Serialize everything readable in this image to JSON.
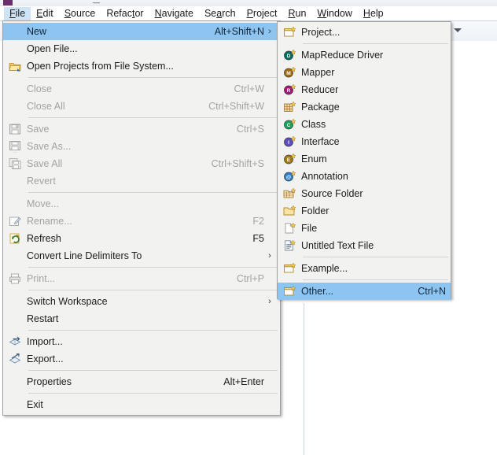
{
  "window": {
    "title_fragment": "",
    "minimize_glyph": "—"
  },
  "menubar": {
    "items": [
      {
        "label": "File",
        "mnemonic": "F",
        "active": true
      },
      {
        "label": "Edit",
        "mnemonic": "E",
        "active": false
      },
      {
        "label": "Source",
        "mnemonic": "S",
        "active": false
      },
      {
        "label": "Refactor",
        "mnemonic": "t",
        "active": false
      },
      {
        "label": "Navigate",
        "mnemonic": "N",
        "active": false
      },
      {
        "label": "Search",
        "mnemonic": "a",
        "active": false
      },
      {
        "label": "Project",
        "mnemonic": "P",
        "active": false
      },
      {
        "label": "Run",
        "mnemonic": "R",
        "active": false
      },
      {
        "label": "Window",
        "mnemonic": "W",
        "active": false
      },
      {
        "label": "Help",
        "mnemonic": "H",
        "active": false
      }
    ]
  },
  "file_menu": {
    "items": [
      {
        "type": "item",
        "label": "New",
        "accel": "Alt+Shift+N",
        "arrow": "›",
        "selected": true,
        "disabled": false,
        "icon": ""
      },
      {
        "type": "item",
        "label": "Open File...",
        "accel": "",
        "arrow": "",
        "selected": false,
        "disabled": false,
        "icon": ""
      },
      {
        "type": "item",
        "label": "Open Projects from File System...",
        "accel": "",
        "arrow": "",
        "selected": false,
        "disabled": false,
        "icon": "open-folder-icon"
      },
      {
        "type": "sep"
      },
      {
        "type": "item",
        "label": "Close",
        "accel": "Ctrl+W",
        "arrow": "",
        "selected": false,
        "disabled": true,
        "icon": ""
      },
      {
        "type": "item",
        "label": "Close All",
        "accel": "Ctrl+Shift+W",
        "arrow": "",
        "selected": false,
        "disabled": true,
        "icon": ""
      },
      {
        "type": "sep"
      },
      {
        "type": "item",
        "label": "Save",
        "accel": "Ctrl+S",
        "arrow": "",
        "selected": false,
        "disabled": true,
        "icon": "save-icon"
      },
      {
        "type": "item",
        "label": "Save As...",
        "accel": "",
        "arrow": "",
        "selected": false,
        "disabled": true,
        "icon": "save-as-icon"
      },
      {
        "type": "item",
        "label": "Save All",
        "accel": "Ctrl+Shift+S",
        "arrow": "",
        "selected": false,
        "disabled": true,
        "icon": "save-all-icon"
      },
      {
        "type": "item",
        "label": "Revert",
        "accel": "",
        "arrow": "",
        "selected": false,
        "disabled": true,
        "icon": ""
      },
      {
        "type": "sep"
      },
      {
        "type": "item",
        "label": "Move...",
        "accel": "",
        "arrow": "",
        "selected": false,
        "disabled": true,
        "icon": ""
      },
      {
        "type": "item",
        "label": "Rename...",
        "accel": "F2",
        "arrow": "",
        "selected": false,
        "disabled": true,
        "icon": "rename-icon"
      },
      {
        "type": "item",
        "label": "Refresh",
        "accel": "F5",
        "arrow": "",
        "selected": false,
        "disabled": false,
        "icon": "refresh-icon"
      },
      {
        "type": "item",
        "label": "Convert Line Delimiters To",
        "accel": "",
        "arrow": "›",
        "selected": false,
        "disabled": false,
        "icon": ""
      },
      {
        "type": "sep"
      },
      {
        "type": "item",
        "label": "Print...",
        "accel": "Ctrl+P",
        "arrow": "",
        "selected": false,
        "disabled": true,
        "icon": "print-icon"
      },
      {
        "type": "sep"
      },
      {
        "type": "item",
        "label": "Switch Workspace",
        "accel": "",
        "arrow": "›",
        "selected": false,
        "disabled": false,
        "icon": ""
      },
      {
        "type": "item",
        "label": "Restart",
        "accel": "",
        "arrow": "",
        "selected": false,
        "disabled": false,
        "icon": ""
      },
      {
        "type": "sep"
      },
      {
        "type": "item",
        "label": "Import...",
        "accel": "",
        "arrow": "",
        "selected": false,
        "disabled": false,
        "icon": "import-icon"
      },
      {
        "type": "item",
        "label": "Export...",
        "accel": "",
        "arrow": "",
        "selected": false,
        "disabled": false,
        "icon": "export-icon"
      },
      {
        "type": "sep"
      },
      {
        "type": "item",
        "label": "Properties",
        "accel": "Alt+Enter",
        "arrow": "",
        "selected": false,
        "disabled": false,
        "icon": ""
      },
      {
        "type": "sep"
      },
      {
        "type": "item",
        "label": "Exit",
        "accel": "",
        "arrow": "",
        "selected": false,
        "disabled": false,
        "icon": ""
      }
    ]
  },
  "new_submenu": {
    "items": [
      {
        "type": "item",
        "label": "Project...",
        "accel": "",
        "selected": false,
        "icon": "new-project-icon"
      },
      {
        "type": "sep"
      },
      {
        "type": "item",
        "label": "MapReduce Driver",
        "accel": "",
        "selected": false,
        "icon": "mapreduce-driver-icon"
      },
      {
        "type": "item",
        "label": "Mapper",
        "accel": "",
        "selected": false,
        "icon": "mapper-icon"
      },
      {
        "type": "item",
        "label": "Reducer",
        "accel": "",
        "selected": false,
        "icon": "reducer-icon"
      },
      {
        "type": "item",
        "label": "Package",
        "accel": "",
        "selected": false,
        "icon": "package-icon"
      },
      {
        "type": "item",
        "label": "Class",
        "accel": "",
        "selected": false,
        "icon": "class-icon"
      },
      {
        "type": "item",
        "label": "Interface",
        "accel": "",
        "selected": false,
        "icon": "interface-icon"
      },
      {
        "type": "item",
        "label": "Enum",
        "accel": "",
        "selected": false,
        "icon": "enum-icon"
      },
      {
        "type": "item",
        "label": "Annotation",
        "accel": "",
        "selected": false,
        "icon": "annotation-icon"
      },
      {
        "type": "item",
        "label": "Source Folder",
        "accel": "",
        "selected": false,
        "icon": "source-folder-icon"
      },
      {
        "type": "item",
        "label": "Folder",
        "accel": "",
        "selected": false,
        "icon": "folder-icon"
      },
      {
        "type": "item",
        "label": "File",
        "accel": "",
        "selected": false,
        "icon": "file-icon"
      },
      {
        "type": "item",
        "label": "Untitled Text File",
        "accel": "",
        "selected": false,
        "icon": "untitled-text-file-icon"
      },
      {
        "type": "sep"
      },
      {
        "type": "item",
        "label": "Example...",
        "accel": "",
        "selected": false,
        "icon": "example-icon"
      },
      {
        "type": "sep"
      },
      {
        "type": "item",
        "label": "Other...",
        "accel": "Ctrl+N",
        "selected": true,
        "icon": "other-icon"
      }
    ]
  },
  "toolbar": {
    "overflow_chevron": "chevron-down-icon"
  },
  "colors": {
    "menu_bg": "#f2f2f0",
    "menu_border": "#a0a0a0",
    "highlight": "#8ec5f0",
    "menubar_active": "#cfe3f7",
    "separator": "#d2d2d0",
    "disabled_text": "#a3a3a3",
    "text": "#1c1c1c"
  }
}
